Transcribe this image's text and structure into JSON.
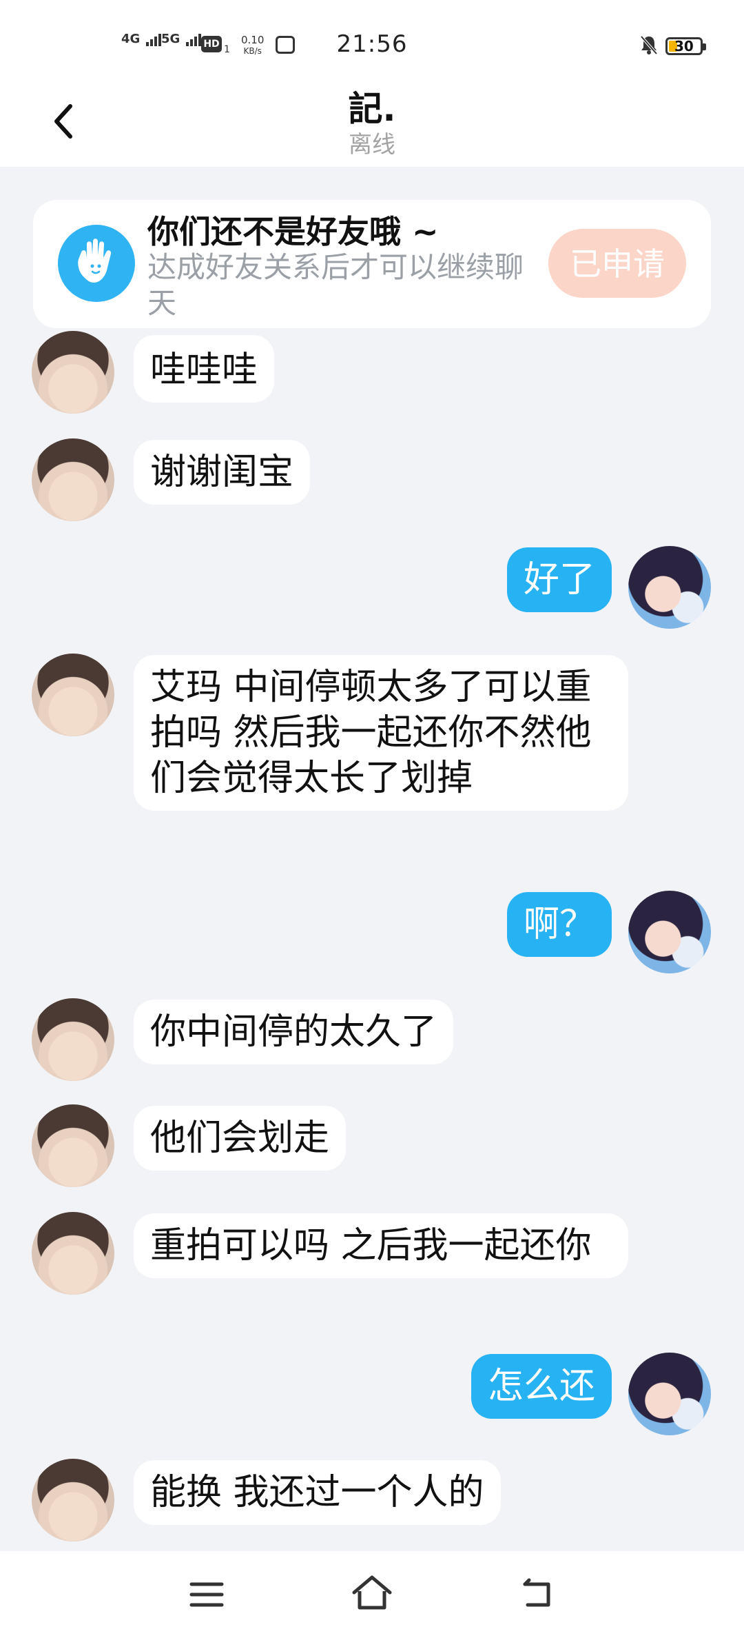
{
  "status_bar": {
    "signal1": "4G",
    "signal2": "5G",
    "hd": "HD",
    "hd_sub": "1",
    "speed_value": "0.10",
    "speed_unit": "KB/s",
    "time": "21:56",
    "battery": "30"
  },
  "header": {
    "title": "記.",
    "subtitle": "离线"
  },
  "banner": {
    "title": "你们还不是好友哦 ~",
    "text": "达成好友关系后才可以继续聊天",
    "button": "已申请"
  },
  "messages": [
    {
      "from": "other",
      "text": "哇哇哇"
    },
    {
      "from": "other",
      "text": "谢谢闺宝"
    },
    {
      "from": "me",
      "text": "好了"
    },
    {
      "from": "other",
      "text": "艾玛 中间停顿太多了可以重拍吗 然后我一起还你不然他们会觉得太长了划掉"
    },
    {
      "from": "me",
      "text": "啊？"
    },
    {
      "from": "other",
      "text": "你中间停的太久了"
    },
    {
      "from": "other",
      "text": "他们会划走"
    },
    {
      "from": "other",
      "text": "重拍可以吗 之后我一起还你"
    },
    {
      "from": "me",
      "text": "怎么还"
    },
    {
      "from": "other",
      "text": "能换 我还过一个人的"
    }
  ],
  "nav": {
    "menu_icon": "menu-icon",
    "home_icon": "home-icon",
    "back_icon": "back-icon"
  }
}
